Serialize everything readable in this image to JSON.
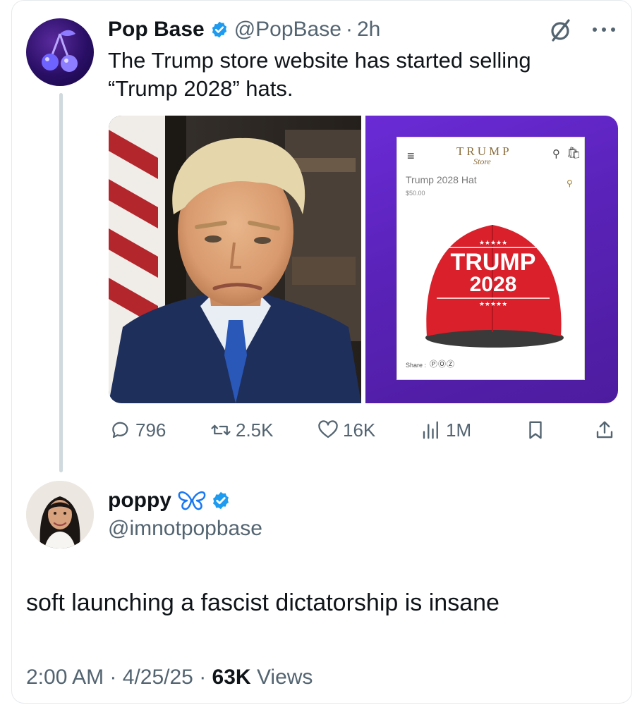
{
  "original_tweet": {
    "author_name": "Pop Base",
    "handle": "@PopBase",
    "separator": "·",
    "time": "2h",
    "text": "The Trump store website has started selling “Trump 2028” hats.",
    "avatar_icon": "cherries-icon",
    "media": {
      "left_image": "portrait-photo",
      "right_image": {
        "store_logo": "TRUMP",
        "store_logo_sub": "Store",
        "product_title": "Trump 2028 Hat",
        "product_price": "$50.00",
        "hat_line1": "TRUMP",
        "hat_line2": "2028",
        "share_label": "Share :",
        "hat_color": "#d9202b"
      }
    },
    "actions": {
      "replies": "796",
      "reposts": "2.5K",
      "likes": "16K",
      "views": "1M"
    }
  },
  "reply_tweet": {
    "author_name": "poppy",
    "handle": "@imnotpopbase",
    "text": "soft launching a fascist dictatorship is insane",
    "time": "2:00 AM",
    "date": "4/25/25",
    "views_count": "63K",
    "views_label": "Views",
    "separator": "·"
  },
  "colors": {
    "text_primary": "#0f1419",
    "text_secondary": "#536471",
    "verified_blue": "#1d9bf0",
    "butterfly_blue": "#1877f2",
    "media_purple": "#5a22b8"
  }
}
